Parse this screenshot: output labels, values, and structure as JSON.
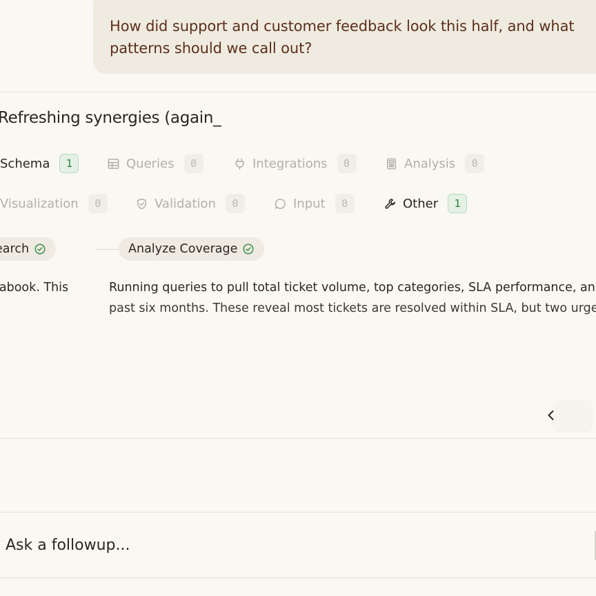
{
  "user_message": {
    "line1": "How did support and customer feedback look this half, and what",
    "line2": "patterns should we call out?"
  },
  "card": {
    "title": "Refreshing synergies (again_",
    "categories": [
      {
        "label": "Schema",
        "count": "1",
        "icon": "database-icon",
        "active": true
      },
      {
        "label": "Queries",
        "count": "0",
        "icon": "table-icon",
        "active": false
      },
      {
        "label": "Integrations",
        "count": "0",
        "icon": "plug-icon",
        "active": false
      },
      {
        "label": "Analysis",
        "count": "0",
        "icon": "calculator-icon",
        "active": false
      },
      {
        "label": "Visualization",
        "count": "0",
        "icon": "chart-icon",
        "active": false
      },
      {
        "label": "Validation",
        "count": "0",
        "icon": "shield-check-icon",
        "active": false
      },
      {
        "label": "Input",
        "count": "0",
        "icon": "message-circle-icon",
        "active": false
      },
      {
        "label": "Other",
        "count": "1",
        "icon": "wrench-icon",
        "active": true
      }
    ],
    "steps": [
      {
        "label": "Schema Search",
        "status_icon": "check-circle-icon"
      },
      {
        "label": "Analyze Coverage",
        "status_icon": "check-circle-icon"
      }
    ],
    "left_text": "tabook. This",
    "right_text": {
      "line1": "Running queries to pull total ticket volume, top categories, SLA performance, and",
      "line2": "past six months. These reveal most tickets are resolved within SLA, but two urgen"
    },
    "nav_icon": "chevron-left-icon"
  },
  "composer": {
    "placeholder": "Ask a followup..."
  },
  "colors": {
    "background": "#faf8f3",
    "user_bubble": "#f0ebe0",
    "user_text": "#5b2f1c",
    "badge_green_bg": "#e5f1e5",
    "badge_green_text": "#2b7a3a",
    "muted_text": "#b3afa7"
  }
}
